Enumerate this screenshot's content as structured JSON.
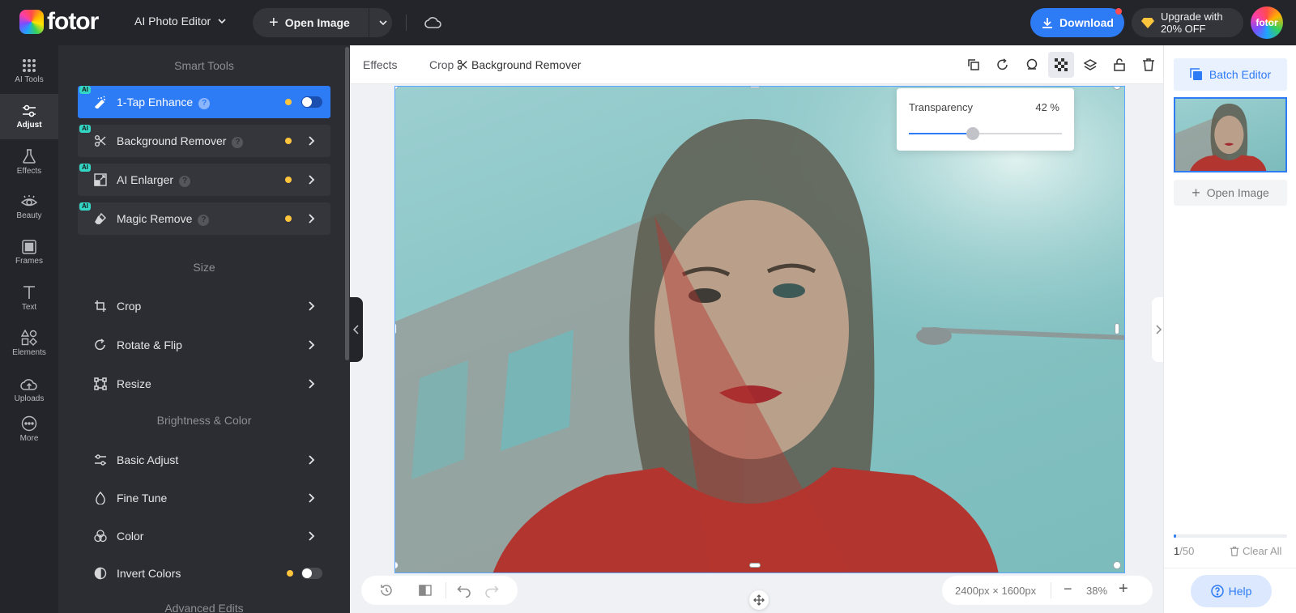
{
  "header": {
    "brand": "fotor",
    "mode": "AI Photo Editor",
    "open_image": "Open Image",
    "download": "Download",
    "upgrade_line1": "Upgrade with",
    "upgrade_line2": "20% OFF",
    "avatar": "fotor"
  },
  "rail": {
    "items": [
      {
        "label": "AI Tools",
        "icon": "grid-dots-icon"
      },
      {
        "label": "Adjust",
        "icon": "sliders-icon"
      },
      {
        "label": "Effects",
        "icon": "flask-icon"
      },
      {
        "label": "Beauty",
        "icon": "eye-icon"
      },
      {
        "label": "Frames",
        "icon": "frame-icon"
      },
      {
        "label": "Text",
        "icon": "text-icon"
      },
      {
        "label": "Elements",
        "icon": "shapes-icon"
      },
      {
        "label": "Uploads",
        "icon": "cloud-upload-icon"
      },
      {
        "label": "More",
        "icon": "more-icon"
      }
    ],
    "active": "Adjust"
  },
  "panel": {
    "smart_tools_title": "Smart Tools",
    "size_title": "Size",
    "brightness_title": "Brightness & Color",
    "advanced_title": "Advanced Edits",
    "ai_badge": "AI",
    "help_mark": "?",
    "smart_tools": [
      {
        "label": "1-Tap Enhance",
        "control": "toggle",
        "toggle_on": true
      },
      {
        "label": "Background Remover",
        "control": "chevron"
      },
      {
        "label": "AI Enlarger",
        "control": "chevron"
      },
      {
        "label": "Magic Remove",
        "control": "chevron"
      }
    ],
    "size_tools": [
      "Crop",
      "Rotate & Flip",
      "Resize"
    ],
    "brightness_tools": [
      "Basic Adjust",
      "Fine Tune",
      "Color",
      "Invert Colors"
    ]
  },
  "toolbar": {
    "effects": "Effects",
    "crop": "Crop",
    "background_remover": "Background Remover"
  },
  "transparency": {
    "label": "Transparency",
    "value": "42 %",
    "fraction": 0.42
  },
  "canvas_info": {
    "dimensions": "2400px × 1600px",
    "zoom": "38%",
    "zoom_minus": "−",
    "zoom_plus": "+"
  },
  "right_panel": {
    "batch_editor": "Batch Editor",
    "open_image": "Open Image",
    "count_current": "1",
    "count_total": "/50",
    "progress_fraction": 0.02,
    "clear_all": "Clear All",
    "help": "Help"
  },
  "colors": {
    "accent": "#2e7bf6",
    "dark_bg": "#24252a",
    "panel_bg": "#2c2d33",
    "ai_badge": "#34d6c6",
    "status_dot": "#ffc53d"
  }
}
